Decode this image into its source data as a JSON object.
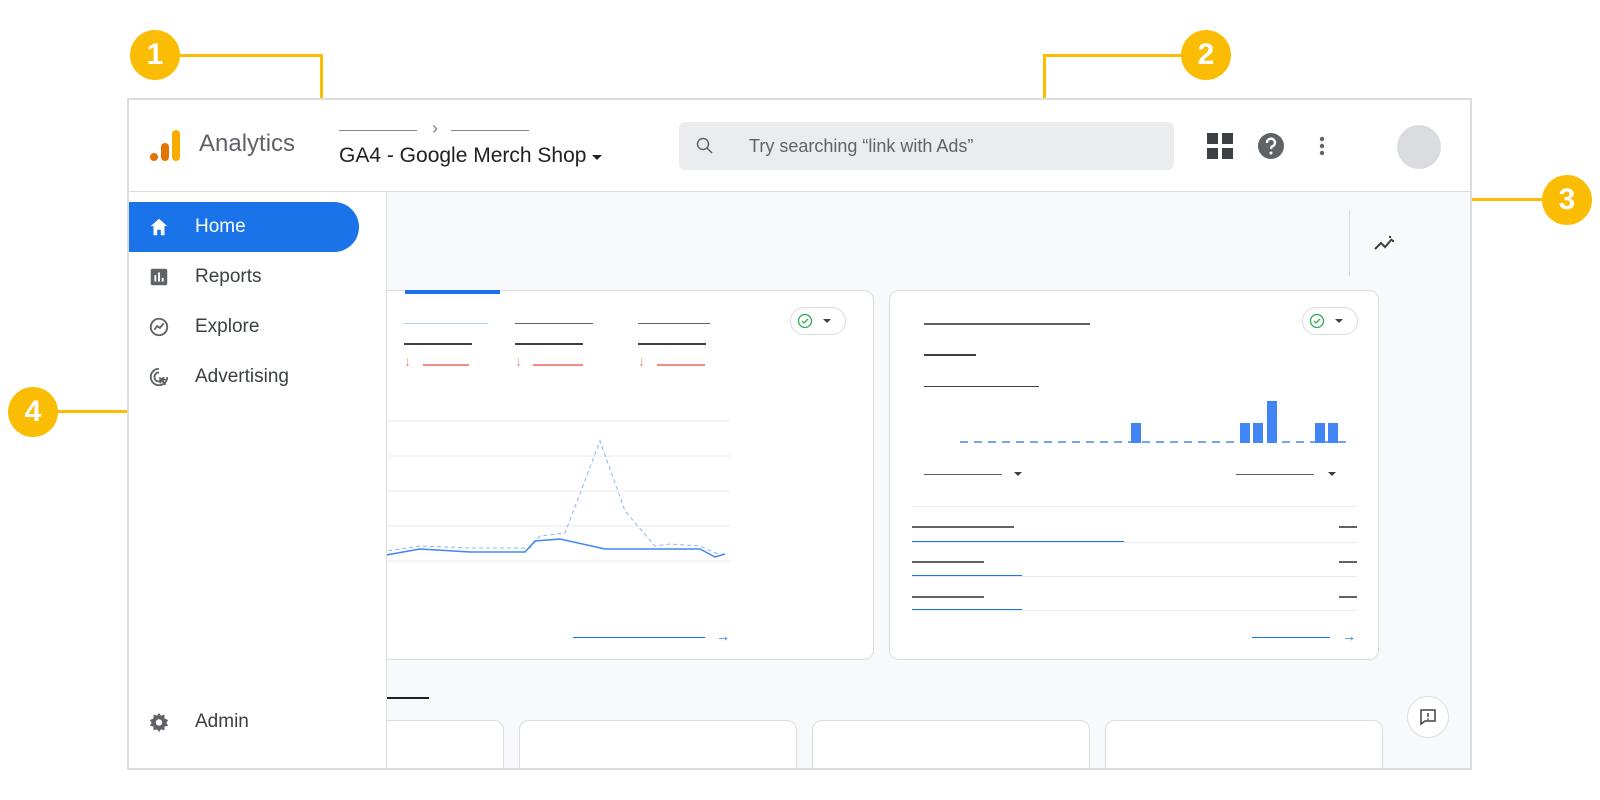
{
  "header": {
    "app_name": "Analytics",
    "property_name": "GA4 - Google Merch Shop",
    "breadcrumb_separator": "›",
    "search": {
      "placeholder": "Try searching “link with Ads”"
    },
    "icons": [
      "apps-grid-icon",
      "help-icon",
      "more-vert-icon",
      "avatar"
    ]
  },
  "sidebar": {
    "items": [
      {
        "label": "Home",
        "icon": "home-icon",
        "active": true
      },
      {
        "label": "Reports",
        "icon": "bar-chart-icon",
        "active": false
      },
      {
        "label": "Explore",
        "icon": "explore-icon",
        "active": false
      },
      {
        "label": "Advertising",
        "icon": "advertising-icon",
        "active": false
      }
    ],
    "admin": {
      "label": "Admin",
      "icon": "gear-icon"
    }
  },
  "callouts": [
    "1",
    "2",
    "3",
    "4"
  ],
  "colors": {
    "accent": "#1a73e8",
    "callout": "#fbbc04",
    "negative": "#f28b82",
    "chart_line": "#4285f4"
  }
}
